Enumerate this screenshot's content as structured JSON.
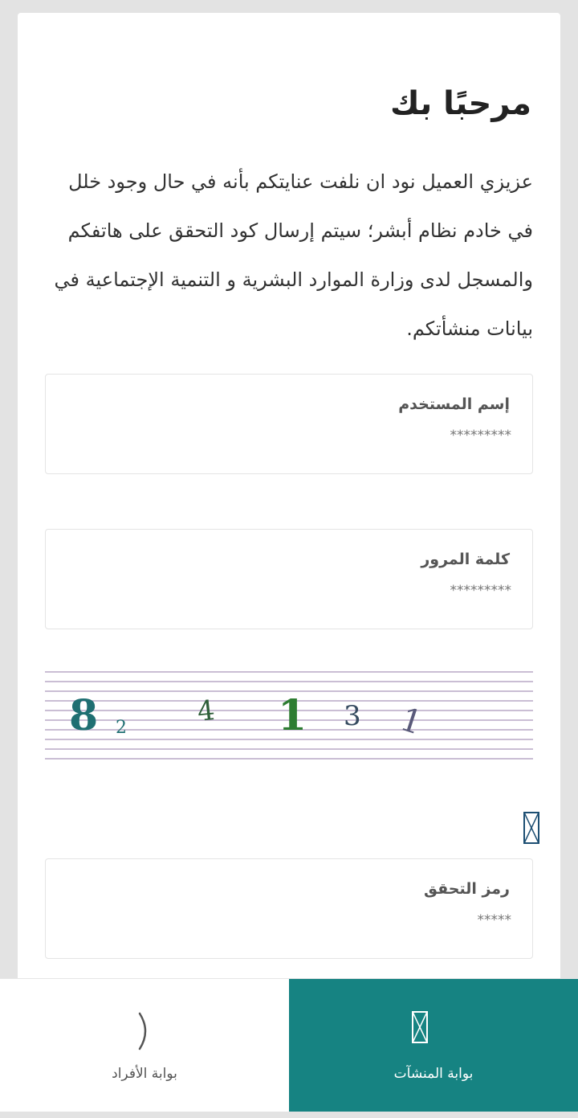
{
  "login": {
    "title": "مرحبًا بك",
    "intro": "عزيزي العميل نود ان نلفت عنايتكم بأنه في حال وجود خلل في خادم نظام أبشر؛ سيتم إرسال كود التحقق على هاتفكم والمسجل لدى وزارة الموارد البشرية و التنمية الإجتماعية في بيانات منشأتكم."
  },
  "fields": {
    "username": {
      "label": "إسم المستخدم",
      "placeholder": "*********"
    },
    "password": {
      "label": "كلمة المرور",
      "placeholder": "*********"
    },
    "code": {
      "label": "رمز التحقق",
      "placeholder": "*****"
    }
  },
  "captcha": {
    "chars": [
      "8",
      "2",
      "4",
      "1",
      "3",
      "1"
    ],
    "colors": [
      "#1f6f72",
      "#1f6f72",
      "#2f5f3a",
      "#2e7d32",
      "#354a5f",
      "#5a5a7a"
    ],
    "line_color": "#b9a8c6"
  },
  "nav": {
    "individuals_label": "بوابة الأفراد",
    "establishments_label": "بوابة المنشآت",
    "active_color": "#168382"
  }
}
